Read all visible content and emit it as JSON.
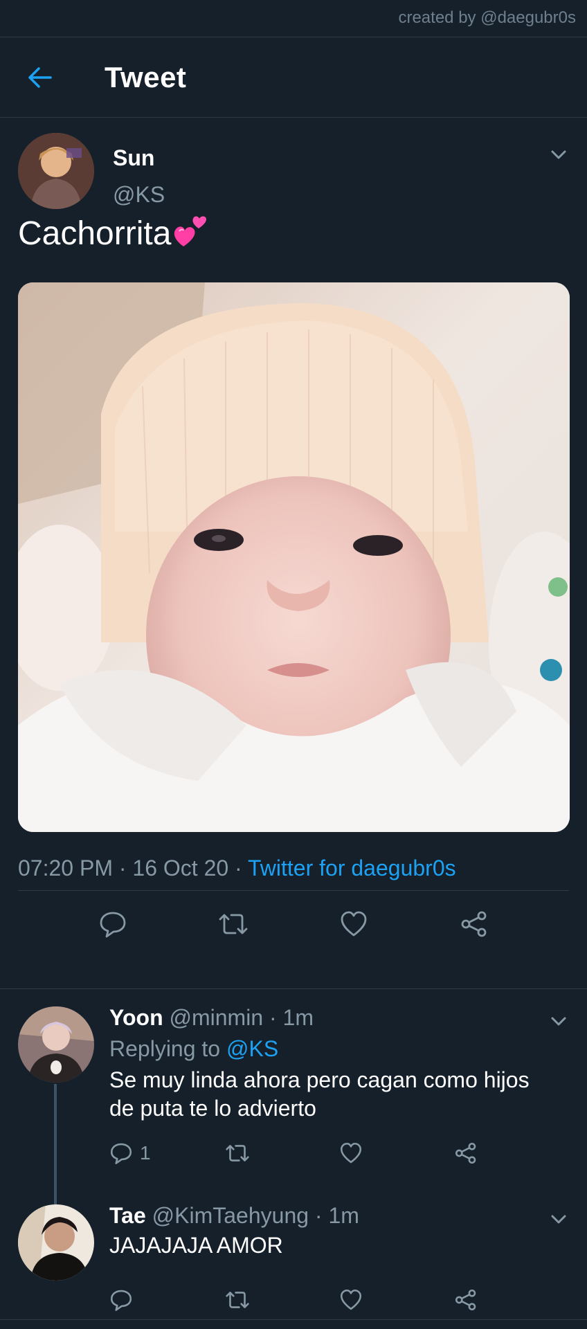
{
  "credit": "created by @daegubr0s",
  "header": {
    "title": "Tweet",
    "back_icon": "arrow-left-icon"
  },
  "tweet": {
    "author_name": "Sun",
    "author_handle": "@KS",
    "text": "Cachorrita",
    "emoji": "two-hearts-emoji",
    "time": "07:20 PM",
    "date": "16 Oct 20",
    "source": "Twitter for daegubr0s"
  },
  "actions": [
    "reply-icon",
    "retweet-icon",
    "like-icon",
    "share-icon"
  ],
  "replies": [
    {
      "name": "Yoon",
      "handle": "@minmin",
      "age": "1m",
      "replying_label": "Replying to",
      "replying_handle": "@KS",
      "text_line1": "Se muy linda ahora pero cagan como hijos",
      "text_line2": "de puta te lo advierto",
      "reply_count": "1"
    },
    {
      "name": "Tae",
      "handle": "@KimTaehyung",
      "age": "1m",
      "text_line1": "JAJAJAJA AMOR"
    }
  ],
  "colors": {
    "background": "#15202b",
    "accent": "#1da1f2",
    "muted": "#8899a6",
    "divider": "#2f3b47"
  }
}
